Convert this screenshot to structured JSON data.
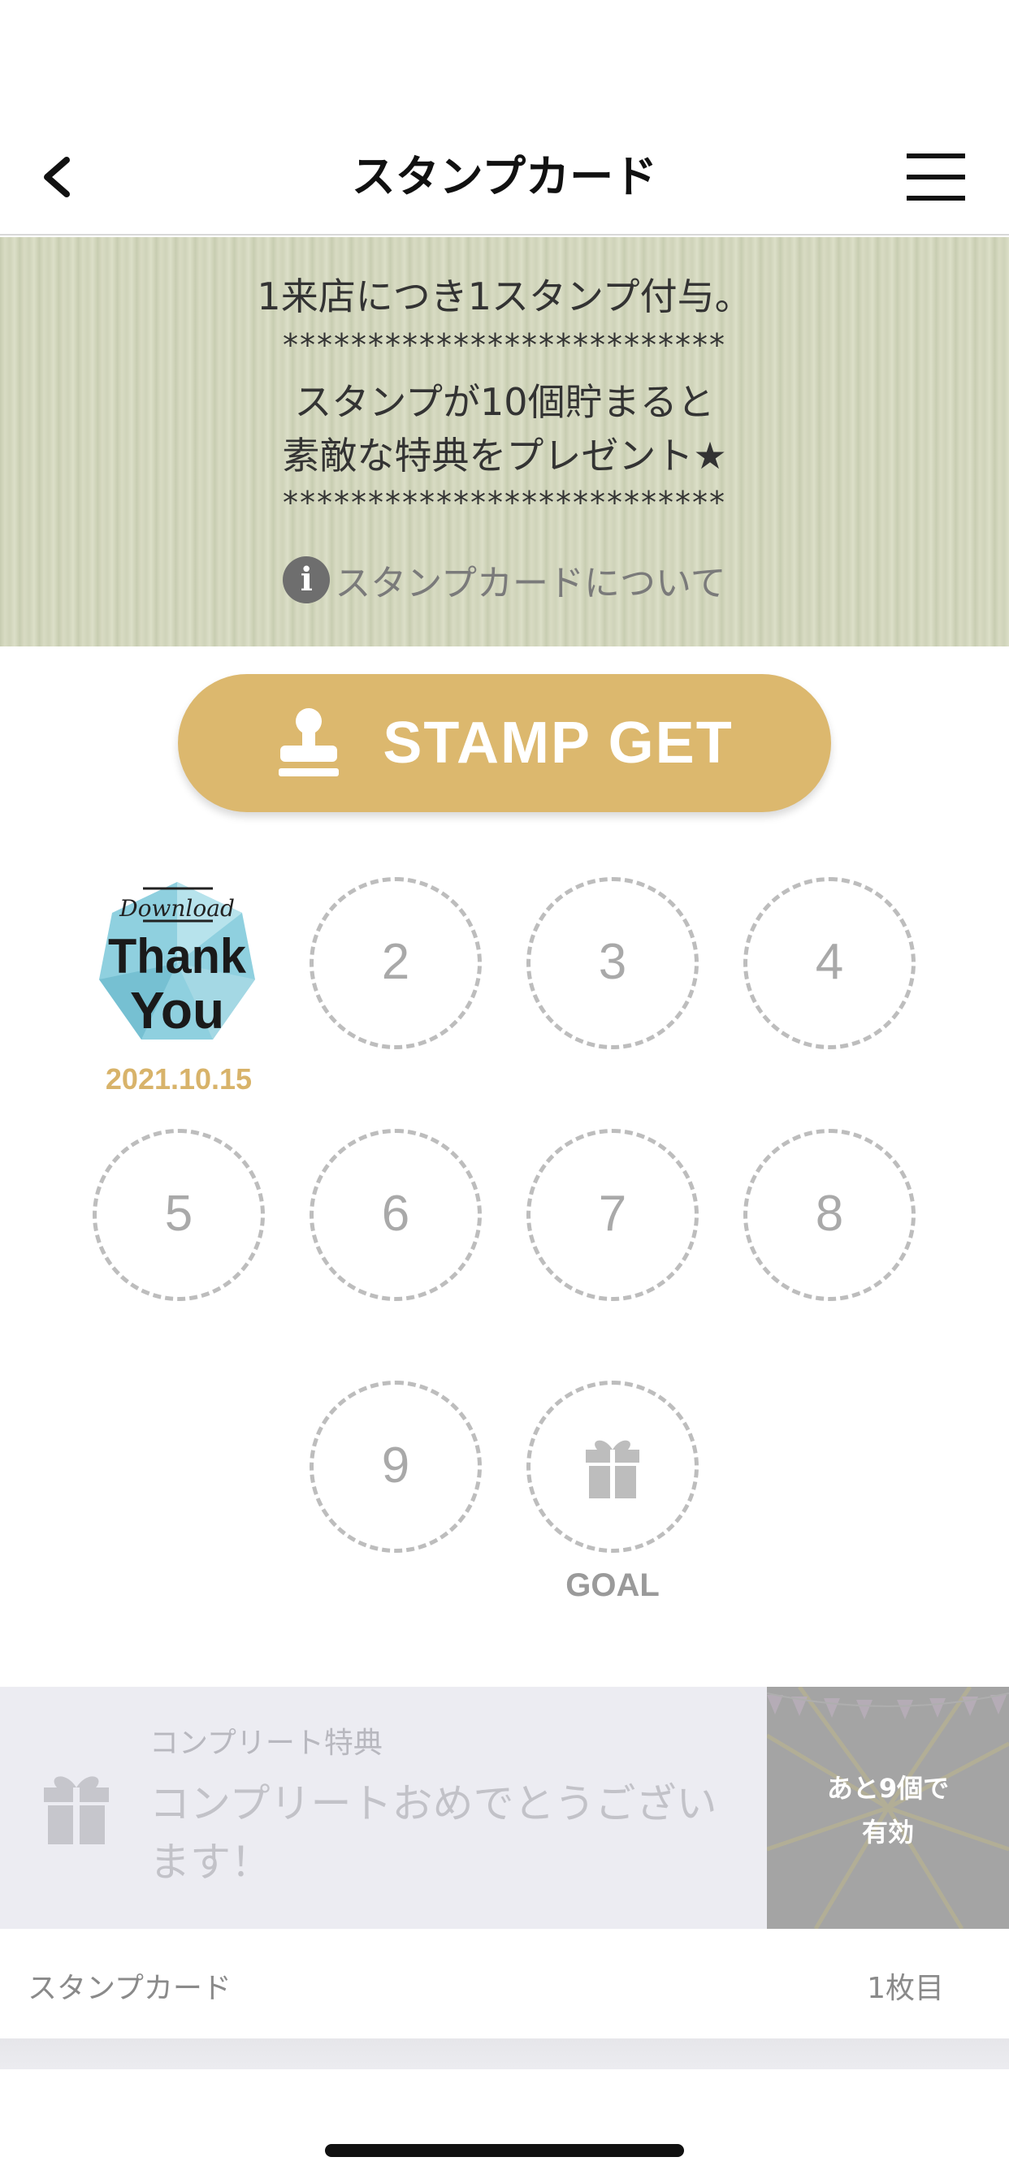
{
  "navbar": {
    "title": "スタンプカード",
    "back_icon": "chevron-left-icon",
    "menu_icon": "hamburger-menu-icon"
  },
  "banner": {
    "line1": "1来店につき1スタンプ付与。",
    "stars1": "**************************",
    "line2": "スタンプが10個貯まると",
    "line3": "素敵な特典をプレゼント★",
    "stars2": "**************************",
    "about_link": "スタンプカードについて",
    "about_icon": "info-icon"
  },
  "stamp_get": {
    "label": "STAMP GET",
    "icon": "stamp-icon",
    "color": "#dcb86e"
  },
  "stamps": {
    "first": {
      "image_text_top": "Download",
      "image_text_1": "Thank",
      "image_text_2": "You",
      "date": "2021.10.15"
    },
    "slots": [
      "2",
      "3",
      "4",
      "5",
      "6",
      "7",
      "8",
      "9"
    ],
    "goal_label": "GOAL",
    "goal_icon": "gift-icon"
  },
  "reward": {
    "caption": "コンプリート特典",
    "text": "コンプリートおめでとうございます！",
    "badge_line1": "あと9個で",
    "badge_line2": "有効",
    "icon": "gift-icon"
  },
  "footer": {
    "left": "スタンプカード",
    "right": "1枚目"
  }
}
